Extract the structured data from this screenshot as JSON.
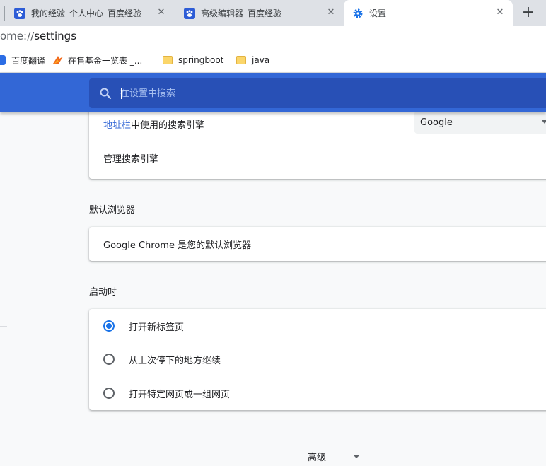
{
  "tabs": [
    {
      "title": "我的经验_个人中心_百度经验",
      "icon": "baidu-paw-icon",
      "active": false
    },
    {
      "title": "高级编辑器_百度经验",
      "icon": "baidu-paw-icon",
      "active": false
    },
    {
      "title": "设置",
      "icon": "gear-icon",
      "active": true
    }
  ],
  "address_bar": {
    "url_prefix": "ome://",
    "url_host": "settings"
  },
  "bookmarks": [
    {
      "label": "百度翻译",
      "icon": "translate-icon"
    },
    {
      "label": "在售基金一览表 _...",
      "icon": "fund-icon"
    },
    {
      "label": "springboot",
      "icon": "folder-icon"
    },
    {
      "label": "java",
      "icon": "folder-icon"
    }
  ],
  "search": {
    "placeholder": "在设置中搜索",
    "value": ""
  },
  "search_engine": {
    "row_prefix_link": "地址栏",
    "row_suffix": "中使用的搜索引擎",
    "selected": "Google",
    "manage_label": "管理搜索引擎"
  },
  "default_browser": {
    "section_title": "默认浏览器",
    "status": "Google Chrome 是您的默认浏览器"
  },
  "on_startup": {
    "section_title": "启动时",
    "options": [
      {
        "label": "打开新标签页",
        "checked": true
      },
      {
        "label": "从上次停下的地方继续",
        "checked": false
      },
      {
        "label": "打开特定网页或一组网页",
        "checked": false
      }
    ]
  },
  "advanced_label": "高级",
  "colors": {
    "header_blue": "#3367d6",
    "search_blue": "#2850b6",
    "radio_blue": "#1a73e8",
    "link_blue": "#3367d6"
  }
}
